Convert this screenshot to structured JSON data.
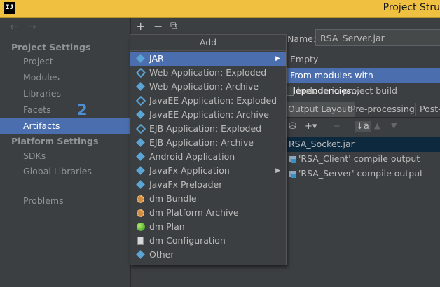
{
  "window": {
    "title": "Project Stru",
    "logo": "IJ"
  },
  "sidebar": {
    "back_icon": "←",
    "forward_icon": "→",
    "project_settings_label": "Project Settings",
    "project_items": [
      "Project",
      "Modules",
      "Libraries",
      "Facets",
      "Artifacts"
    ],
    "platform_settings_label": "Platform Settings",
    "platform_items": [
      "SDKs",
      "Global Libraries"
    ],
    "problems_label": "Problems",
    "selected": "Artifacts",
    "annotation": "2"
  },
  "toolbar": {
    "add_icon": "+",
    "remove_icon": "−",
    "copy_icon": "⧉"
  },
  "popup": {
    "title": "Add",
    "items": [
      {
        "label": "JAR",
        "icon": "diamond-icon",
        "submenu": true
      },
      {
        "label": "Web Application: Exploded",
        "icon": "diamond-icon"
      },
      {
        "label": "Web Application: Archive",
        "icon": "diamond-icon"
      },
      {
        "label": "JavaEE Application: Exploded",
        "icon": "diamond-icon"
      },
      {
        "label": "JavaEE Application: Archive",
        "icon": "diamond-icon"
      },
      {
        "label": "EJB Application: Exploded",
        "icon": "diamond-icon"
      },
      {
        "label": "EJB Application: Archive",
        "icon": "diamond-icon"
      },
      {
        "label": "Android Application",
        "icon": "diamond-icon"
      },
      {
        "label": "JavaFx Application",
        "icon": "diamond-icon",
        "submenu": true
      },
      {
        "label": "JavaFx Preloader",
        "icon": "diamond-icon"
      },
      {
        "label": "dm Bundle",
        "icon": "gear-icon"
      },
      {
        "label": "dm Platform Archive",
        "icon": "gear-icon"
      },
      {
        "label": "dm Plan",
        "icon": "globe-icon"
      },
      {
        "label": "dm Configuration",
        "icon": "document-icon"
      },
      {
        "label": "Other",
        "icon": "diamond-icon"
      }
    ],
    "submenu_arrow": "▶"
  },
  "jar_submenu": {
    "items": [
      "Empty",
      "From modules with dependencies..."
    ],
    "highlighted": "From modules with dependencies..."
  },
  "right_panel": {
    "name_label": "Name:",
    "name_value": "RSA_Server.jar",
    "include_label": "Include in project build",
    "tabs": [
      "Output Layout",
      "Pre-processing",
      "Post-"
    ],
    "selected_tab": "Output Layout",
    "tool_icons": [
      "⛁",
      "+▾",
      "−",
      "↓a",
      "▲",
      "▼"
    ],
    "tree": [
      "RSA_Socket.jar",
      "'RSA_Client' compile output",
      "'RSA_Server' compile output"
    ]
  },
  "colors": {
    "selection": "#4b6eaf",
    "panel": "#3c3f41",
    "title_bar": "#f0c040"
  }
}
